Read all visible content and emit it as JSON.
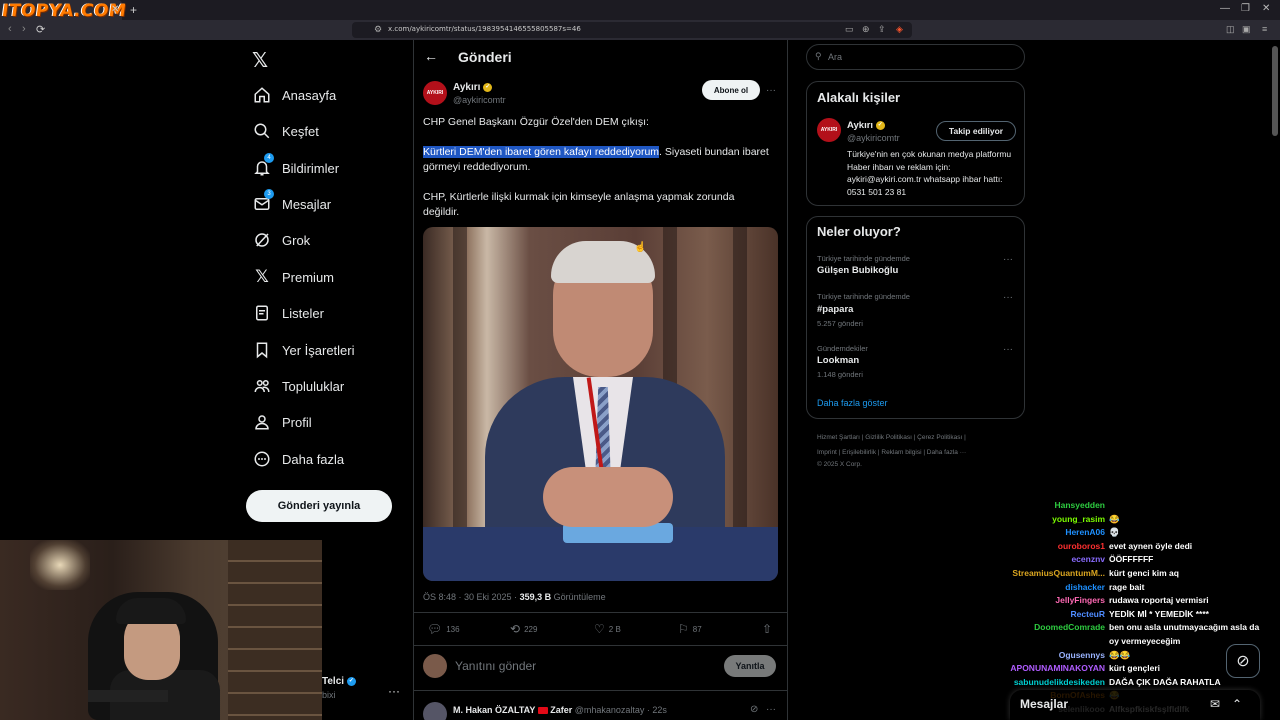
{
  "browser": {
    "watermark": "ITOPYA.COM",
    "url": "x.com/aykiricomtr/status/1983954146555805587s=46"
  },
  "nav": {
    "items": [
      {
        "label": "Anasayfa",
        "icon": "home-icon"
      },
      {
        "label": "Keşfet",
        "icon": "search-icon"
      },
      {
        "label": "Bildirimler",
        "icon": "bell-icon",
        "badge": "4"
      },
      {
        "label": "Mesajlar",
        "icon": "mail-icon",
        "badge": "3"
      },
      {
        "label": "Grok",
        "icon": "grok-icon"
      },
      {
        "label": "Premium",
        "icon": "x-icon"
      },
      {
        "label": "Listeler",
        "icon": "list-icon"
      },
      {
        "label": "Yer İşaretleri",
        "icon": "bookmark-icon"
      },
      {
        "label": "Topluluklar",
        "icon": "communities-icon"
      },
      {
        "label": "Profil",
        "icon": "profile-icon"
      },
      {
        "label": "Daha fazla",
        "icon": "more-circle-icon"
      }
    ],
    "post_button": "Gönderi yayınla"
  },
  "account": {
    "name": "Telci",
    "handle": "bixi"
  },
  "header": {
    "title": "Gönderi"
  },
  "tweet": {
    "avatar_text": "AYKIRI",
    "author": "Aykırı",
    "handle": "@aykiricomtr",
    "follow_label": "Abone ol",
    "line1": "CHP Genel Başkanı Özgür Özel'den DEM çıkışı:",
    "highlight": "Kürtleri DEM'den ibaret gören kafayı reddediyorum",
    "line2_rest": ". Siyaseti bundan ibaret görmeyi reddediyorum.",
    "line3": "CHP, Kürtlerle ilişki kurmak için kimseyle anlaşma yapmak zorunda değildir.",
    "timestamp": "ÖS 8:48 · 30 Eki 2025 · ",
    "views": "359,3 B",
    "views_label": " Görüntüleme",
    "replies": "136",
    "reposts": "229",
    "likes": "2 B",
    "bookmarks": "87"
  },
  "reply": {
    "placeholder": "Yanıtını gönder",
    "button": "Yanıtla"
  },
  "next_tweet": {
    "author": "M. Hakan ÖZALTAY",
    "tag": "Zafer",
    "handle": "@mhakanozaltay · 22s"
  },
  "search": {
    "placeholder": "Ara"
  },
  "related": {
    "title": "Alakalı kişiler",
    "avatar_text": "AYKIRI",
    "name": "Aykırı",
    "handle": "@aykiricomtr",
    "button": "Takip ediliyor",
    "bio": "Türkiye'nin en çok okunan medya platformu Haber ihbarı ve reklam için: aykiri@aykiri.com.tr whatsapp ihbar hattı: 0531 501 23 81"
  },
  "trends": {
    "title": "Neler oluyor?",
    "items": [
      {
        "context": "Türkiye tarihinde gündemde",
        "name": "Gülşen Bubikoğlu",
        "count": ""
      },
      {
        "context": "Türkiye tarihinde gündemde",
        "name": "#papara",
        "count": "5.257 gönderi"
      },
      {
        "context": "Gündemdekiler",
        "name": "Lookman",
        "count": "1.148 gönderi"
      }
    ],
    "show_more": "Daha fazla göster"
  },
  "footer": {
    "row1": "Hizmet Şartları   |   Gizlilik Politikası   |   Çerez Politikası   |",
    "row2": "Imprint   |   Erişilebilirlik   |   Reklam bilgisi   |   Daha fazla ···",
    "row3": "© 2025 X Corp."
  },
  "chat": [
    {
      "user": "Hansyedden",
      "color": "#2ecc40",
      "msg": ""
    },
    {
      "user": "young_rasim",
      "color": "#7cfc00",
      "msg": "😂"
    },
    {
      "user": "HerenA06",
      "color": "#1e90ff",
      "msg": "💀"
    },
    {
      "user": "ouroboros1",
      "color": "#ff3030",
      "msg": "evet aynen öyle dedi"
    },
    {
      "user": "ecenznv",
      "color": "#8a6cff",
      "msg": "ÖÖFFFFFF"
    },
    {
      "user": "StreamiusQuantumM...",
      "color": "#daa520",
      "msg": "kürt genci kim aq"
    },
    {
      "user": "dishacker",
      "color": "#1e90ff",
      "msg": "rage bait"
    },
    {
      "user": "JellyFingers",
      "color": "#ff69b4",
      "msg": "rudawa roportaj vermisri"
    },
    {
      "user": "RecteuR",
      "color": "#4f8cff",
      "msg": "YEDİK Mİ * YEMEDİK ****"
    },
    {
      "user": "DoomedComrade",
      "color": "#2ecc40",
      "msg": "ben onu asla unutmayacağım asla da"
    },
    {
      "user": "",
      "color": "#ffffff",
      "msg": "oy vermeyeceğim"
    },
    {
      "user": "Ogusennys",
      "color": "#9ab4ff",
      "msg": "😂😂"
    },
    {
      "user": "APONUNAMINAKOYAN",
      "color": "#b05cff",
      "msg": "kürt gençleri"
    },
    {
      "user": "sabunudelikdesikeden",
      "color": "#00ced1",
      "msg": "DAĞA ÇIK DAĞA RAHATLA"
    },
    {
      "user": "BornOfAshes",
      "color": "#ff8c00",
      "msg": "😂"
    },
    {
      "user": "selenlikooo",
      "color": "#cfcfcf",
      "msg": "Alfkspfkiskfsşlfldlfk"
    }
  ],
  "messages_bar": {
    "label": "Mesajlar"
  }
}
